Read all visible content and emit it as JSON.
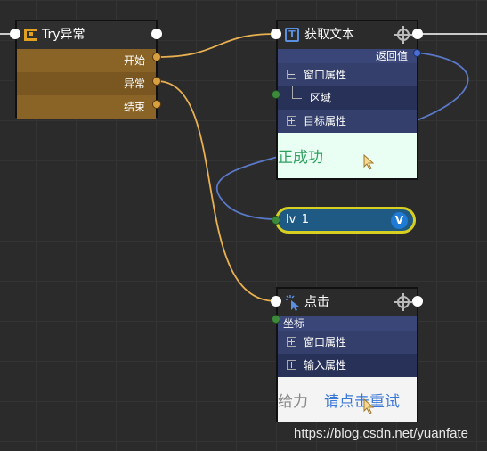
{
  "try_node": {
    "title": "Try异常",
    "rows": [
      "开始",
      "异常",
      "结束"
    ]
  },
  "get_text_node": {
    "title": "获取文本",
    "return_label": "返回值",
    "rows": [
      "窗口属性",
      "区域",
      "目标属性"
    ],
    "preview_text": "正成功"
  },
  "variable": {
    "name": "lv_1",
    "badge": "V"
  },
  "click_node": {
    "title": "点击",
    "coord_label": "坐标",
    "rows": [
      "窗口属性",
      "输入属性"
    ],
    "preview_text_gray": "给力",
    "preview_text_blue": "请点击重试"
  },
  "watermark": "https://blog.csdn.net/yuanfate",
  "colors": {
    "canvas": "#2b2b2b",
    "try_body": "#7a5a23",
    "node_body": "#2c3454",
    "wire_flow": "#e8b050",
    "wire_data": "#5a78c8",
    "pill_border": "#d8d020",
    "pill_fill": "#1e5a84"
  }
}
